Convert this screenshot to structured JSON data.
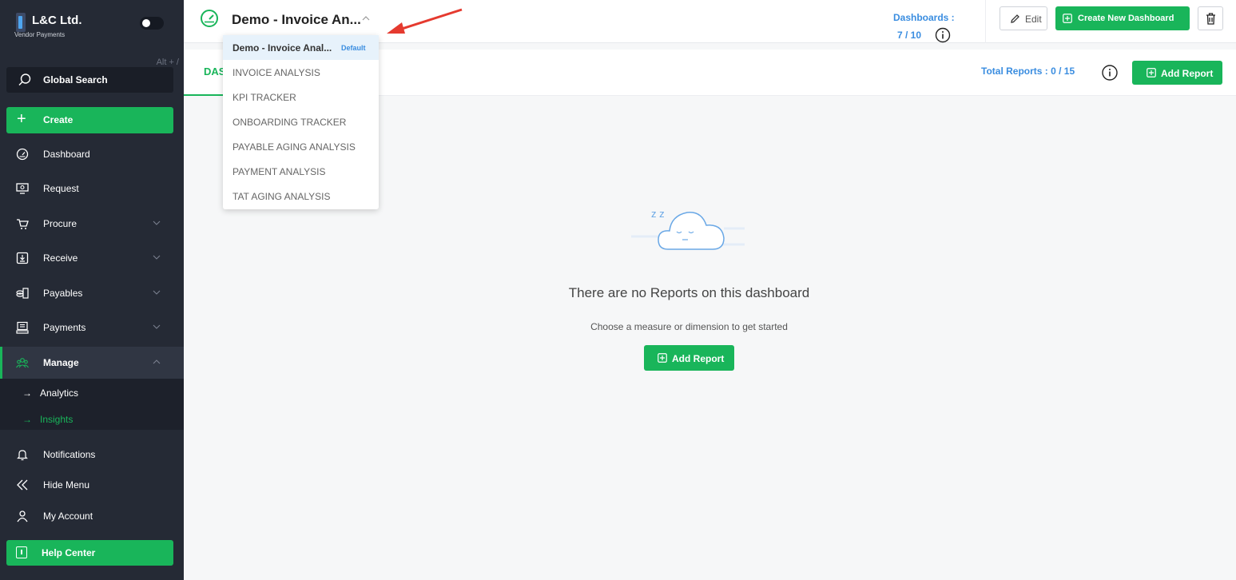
{
  "brand": {
    "name": "L&C Ltd.",
    "subtitle": "Vendor Payments",
    "shortcut_hint": "Alt + /"
  },
  "sidebar": {
    "search_label": "Global Search",
    "create_label": "Create",
    "items": [
      {
        "label": "Dashboard",
        "icon": "speedometer-icon"
      },
      {
        "label": "Request",
        "icon": "request-icon"
      },
      {
        "label": "Procure",
        "icon": "cart-icon"
      },
      {
        "label": "Receive",
        "icon": "receive-icon"
      },
      {
        "label": "Payables",
        "icon": "coins-icon"
      },
      {
        "label": "Payments",
        "icon": "payments-icon"
      },
      {
        "label": "Manage",
        "icon": "team-icon"
      }
    ],
    "sub_items": [
      {
        "label": "Analytics"
      },
      {
        "label": "Insights"
      }
    ],
    "bottom_items": [
      {
        "label": "Notifications",
        "icon": "bell-icon"
      },
      {
        "label": "Hide Menu",
        "icon": "double-chevron-left-icon"
      },
      {
        "label": "My Account",
        "icon": "user-icon"
      }
    ],
    "help_label": "Help Center"
  },
  "header": {
    "dashboard_title": "Demo - Invoice An...",
    "dashboards_label": "Dashboards :",
    "dashboards_count": "7 / 10",
    "edit_label": "Edit",
    "create_dashboard_label": "Create New Dashboard"
  },
  "tabbar": {
    "tab_label": "DAS",
    "total_reports_label": "Total Reports :  0  /  15",
    "add_report_label": "Add Report"
  },
  "dropdown": {
    "items": [
      {
        "label": "Demo - Invoice Anal...",
        "badge": "Default"
      },
      {
        "label": "INVOICE ANALYSIS"
      },
      {
        "label": "KPI TRACKER"
      },
      {
        "label": "ONBOARDING TRACKER"
      },
      {
        "label": "PAYABLE AGING ANALYSIS"
      },
      {
        "label": "PAYMENT ANALYSIS"
      },
      {
        "label": "TAT AGING ANALYSIS"
      }
    ]
  },
  "empty_state": {
    "title": "There are no Reports on this dashboard",
    "subtitle": "Choose a measure or dimension to get started",
    "button_label": "Add Report",
    "sleep_text": "z z"
  },
  "colors": {
    "accent_green": "#19b55a",
    "link_blue": "#3a8de0",
    "sidebar_bg": "#252a35",
    "annotation_red": "#e53a2f"
  }
}
